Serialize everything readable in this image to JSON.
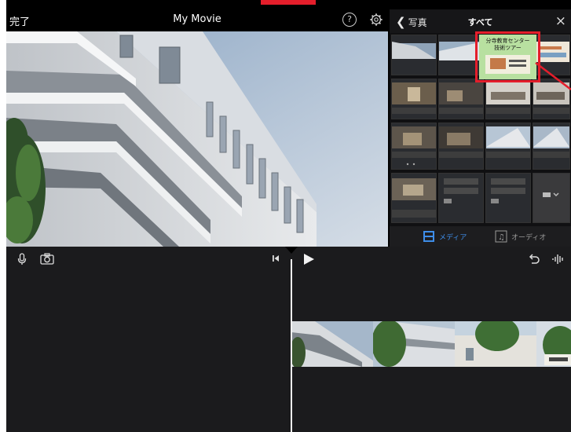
{
  "topbar": {
    "done_label": "完了",
    "title": "My Movie",
    "help_label": "?"
  },
  "media_browser": {
    "back_label": "写真",
    "title": "すべて",
    "close_label": "×",
    "highlighted_item": {
      "line1": "分寺教育センター",
      "line2": "技術ツアー"
    },
    "tabs": [
      {
        "label": "メディア",
        "selected": true
      },
      {
        "label": "オーディオ",
        "selected": false
      }
    ]
  },
  "colors": {
    "accent": "#3e8de8",
    "highlight": "#e41e2b",
    "background": "#1b1b1d"
  },
  "icons": [
    "settings-icon",
    "microphone-icon",
    "camera-icon",
    "rewind-icon",
    "play-icon",
    "undo-icon",
    "audio-waveform-icon"
  ]
}
